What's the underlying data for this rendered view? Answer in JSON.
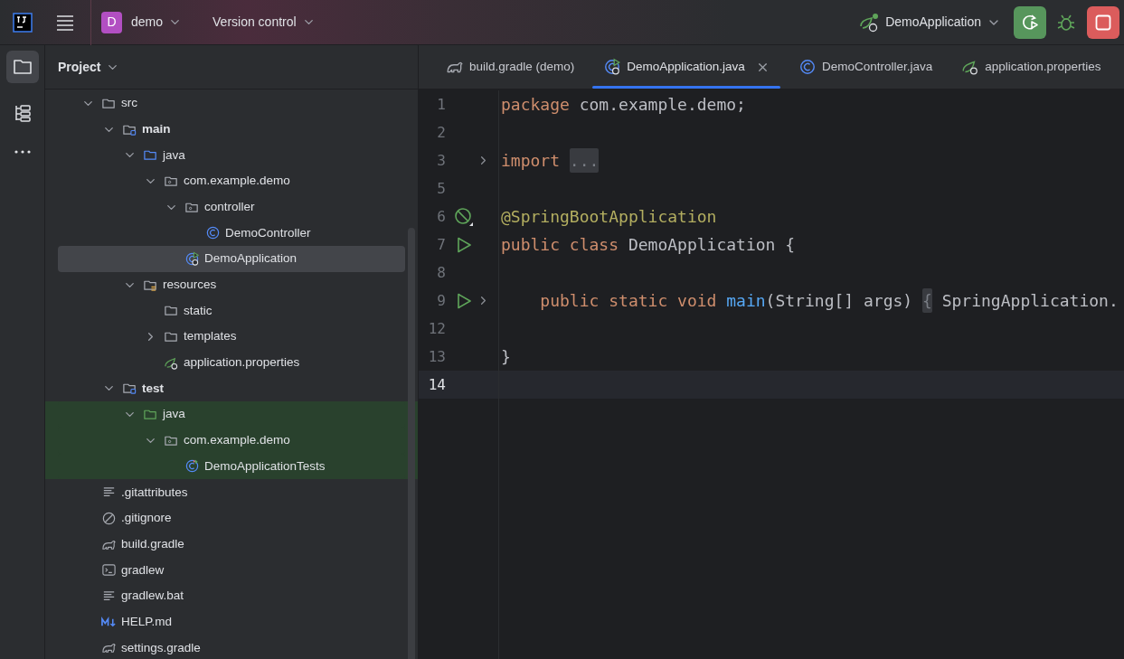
{
  "title_bar": {
    "project_badge": "D",
    "project": "demo",
    "vcs": "Version control",
    "run_config": "DemoApplication"
  },
  "tool_strip": [
    {
      "kind": "project",
      "selected": true
    },
    {
      "kind": "structure",
      "selected": false
    },
    {
      "kind": "more",
      "selected": false
    }
  ],
  "project_panel": {
    "title": "Project",
    "tree": [
      {
        "label": "src",
        "kind": "folder",
        "expanded": true,
        "bold": false,
        "selected": false,
        "highlighted": false,
        "children": [
          {
            "label": "main",
            "kind": "module-folder",
            "expanded": true,
            "bold": true,
            "selected": false,
            "highlighted": false,
            "children": [
              {
                "label": "java",
                "kind": "source-folder",
                "expanded": true,
                "bold": false,
                "selected": false,
                "highlighted": false,
                "children": [
                  {
                    "label": "com.example.demo",
                    "kind": "package",
                    "expanded": true,
                    "bold": false,
                    "selected": false,
                    "highlighted": false,
                    "children": [
                      {
                        "label": "controller",
                        "kind": "package",
                        "expanded": true,
                        "bold": false,
                        "selected": false,
                        "highlighted": false,
                        "children": [
                          {
                            "label": "DemoController",
                            "kind": "class",
                            "bold": false,
                            "selected": false,
                            "highlighted": false
                          }
                        ]
                      },
                      {
                        "label": "DemoApplication",
                        "kind": "spring-class",
                        "bold": false,
                        "selected": true,
                        "highlighted": false
                      }
                    ]
                  }
                ]
              },
              {
                "label": "resources",
                "kind": "resources-folder",
                "expanded": true,
                "bold": false,
                "selected": false,
                "highlighted": false,
                "children": [
                  {
                    "label": "static",
                    "kind": "folder",
                    "bold": false,
                    "selected": false,
                    "highlighted": false
                  },
                  {
                    "label": "templates",
                    "kind": "folder",
                    "expanded": false,
                    "bold": false,
                    "selected": false,
                    "highlighted": false
                  },
                  {
                    "label": "application.properties",
                    "kind": "spring-config",
                    "bold": false,
                    "selected": false,
                    "highlighted": false
                  }
                ]
              }
            ]
          },
          {
            "label": "test",
            "kind": "module-folder",
            "expanded": true,
            "bold": true,
            "selected": false,
            "highlighted": false,
            "children": [
              {
                "label": "java",
                "kind": "test-folder",
                "expanded": true,
                "bold": false,
                "selected": false,
                "highlighted": true,
                "children": [
                  {
                    "label": "com.example.demo",
                    "kind": "package",
                    "expanded": true,
                    "bold": false,
                    "selected": false,
                    "highlighted": true,
                    "children": [
                      {
                        "label": "DemoApplicationTests",
                        "kind": "test-class",
                        "bold": false,
                        "selected": false,
                        "highlighted": true
                      }
                    ]
                  }
                ]
              }
            ]
          }
        ]
      },
      {
        "label": ".gitattributes",
        "kind": "text-file",
        "bold": false,
        "selected": false,
        "highlighted": false
      },
      {
        "label": ".gitignore",
        "kind": "ignore-file",
        "bold": false,
        "selected": false,
        "highlighted": false
      },
      {
        "label": "build.gradle",
        "kind": "gradle",
        "bold": false,
        "selected": false,
        "highlighted": false
      },
      {
        "label": "gradlew",
        "kind": "terminal-file",
        "bold": false,
        "selected": false,
        "highlighted": false
      },
      {
        "label": "gradlew.bat",
        "kind": "text-file",
        "bold": false,
        "selected": false,
        "highlighted": false
      },
      {
        "label": "HELP.md",
        "kind": "markdown",
        "bold": false,
        "selected": false,
        "highlighted": false
      },
      {
        "label": "settings.gradle",
        "kind": "gradle",
        "bold": false,
        "selected": false,
        "highlighted": false
      }
    ]
  },
  "tabs": [
    {
      "label": "build.gradle (demo)",
      "kind": "gradle",
      "selected": false,
      "closable": false
    },
    {
      "label": "DemoApplication.java",
      "kind": "spring-class",
      "selected": true,
      "closable": true
    },
    {
      "label": "DemoController.java",
      "kind": "class",
      "selected": false,
      "closable": false
    },
    {
      "label": "application.properties",
      "kind": "spring-config",
      "selected": false,
      "closable": false
    }
  ],
  "editor": {
    "lines": [
      {
        "number": "1",
        "kind": "plain",
        "current": false,
        "tokens": [
          {
            "kind": "keyword",
            "text": "package"
          },
          {
            "kind": "plain",
            "text": " com.example.demo;"
          }
        ]
      },
      {
        "number": "2",
        "kind": "plain",
        "current": false
      },
      {
        "number": "3",
        "kind": "plain",
        "current": false,
        "fold": true,
        "tokens": [
          {
            "kind": "keyword",
            "text": "import"
          },
          {
            "kind": "folded",
            "text": "..."
          }
        ]
      },
      {
        "number": "5",
        "kind": "plain",
        "current": false
      },
      {
        "number": "6",
        "kind": "bean",
        "current": false,
        "tokens": [
          {
            "kind": "annotation",
            "text": "@SpringBootApplication"
          }
        ]
      },
      {
        "number": "7",
        "kind": "run",
        "current": false,
        "tokens": [
          {
            "kind": "keyword",
            "text": "public class"
          },
          {
            "kind": "plain",
            "text": " DemoApplication {"
          }
        ]
      },
      {
        "number": "8",
        "kind": "plain",
        "current": false
      },
      {
        "number": "9",
        "kind": "run",
        "current": false,
        "fold": true,
        "tokens": [
          {
            "kind": "keyword",
            "text": "    public static void"
          },
          {
            "kind": "method",
            "text": " main"
          },
          {
            "kind": "plain",
            "text": "(String[] args)"
          },
          {
            "kind": "folded",
            "text": "{"
          },
          {
            "kind": "plain",
            "text": " SpringApplication."
          }
        ]
      },
      {
        "number": "12",
        "kind": "plain",
        "current": false
      },
      {
        "number": "13",
        "kind": "plain",
        "current": false,
        "tokens": [
          {
            "kind": "plain",
            "text": "}"
          }
        ]
      },
      {
        "number": "14",
        "kind": "plain",
        "current": true
      }
    ]
  }
}
